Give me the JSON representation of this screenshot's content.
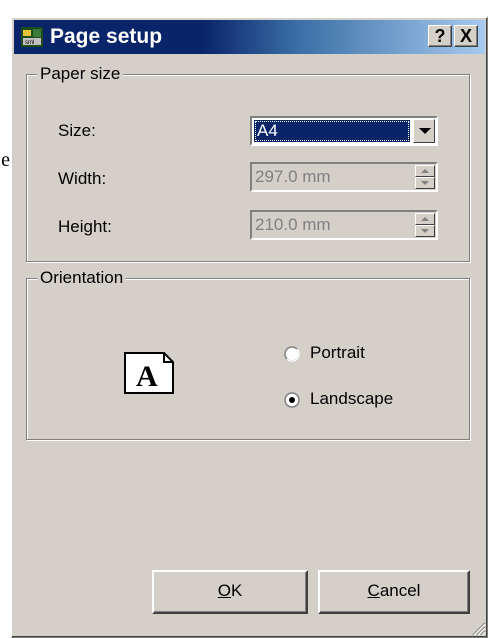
{
  "background_fragment": "e",
  "window": {
    "title": "Page setup",
    "help_label": "?",
    "close_label": "X"
  },
  "paper_size": {
    "legend": "Paper size",
    "size_label": "Size:",
    "size_value": "A4",
    "width_label": "Width:",
    "width_value": "297.0 mm",
    "height_label": "Height:",
    "height_value": "210.0 mm"
  },
  "orientation": {
    "legend": "Orientation",
    "page_icon_letter": "A",
    "portrait_label": "Portrait",
    "landscape_label": "Landscape",
    "selected": "Landscape"
  },
  "buttons": {
    "ok_underlined": "O",
    "ok_rest": "K",
    "cancel_underlined": "C",
    "cancel_rest": "ancel"
  },
  "colors": {
    "title_bar": "#0a246a",
    "dialog_face": "#d4d0c8"
  }
}
